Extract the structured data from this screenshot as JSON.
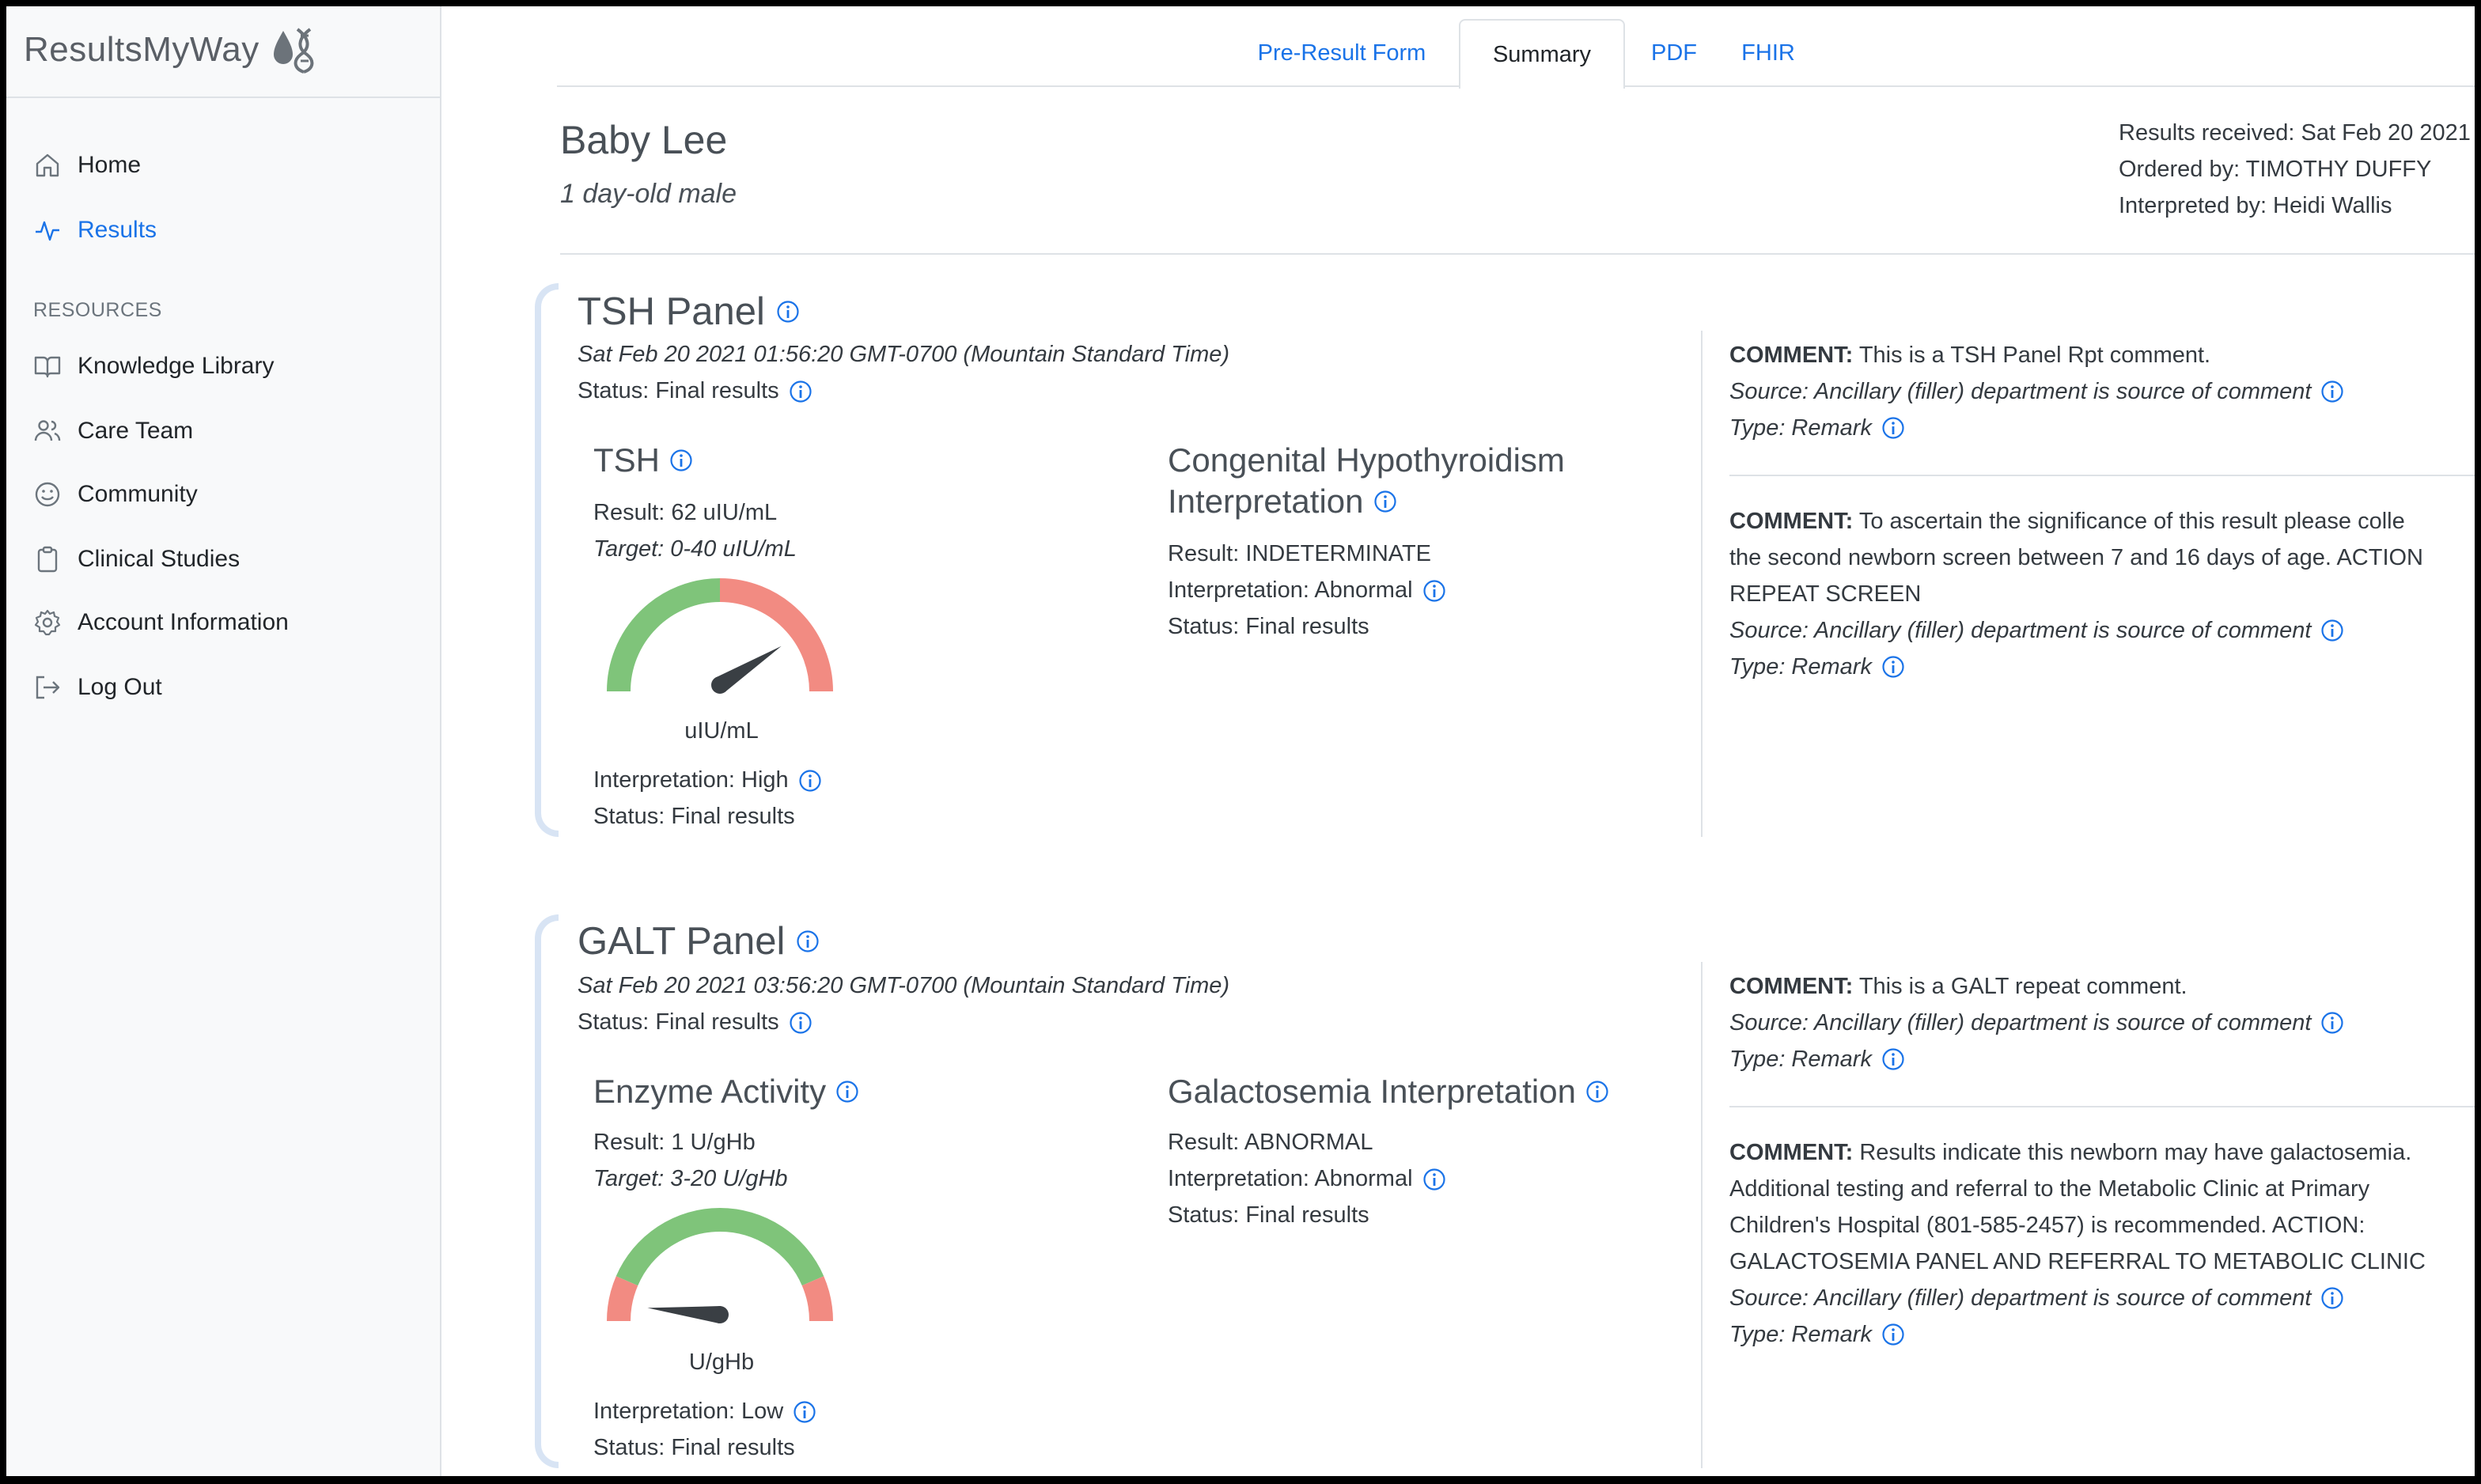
{
  "app": {
    "name": "ResultsMyWay"
  },
  "sidebar": {
    "nav": [
      {
        "label": "Home",
        "icon": "home-icon"
      },
      {
        "label": "Results",
        "icon": "activity-icon",
        "active": true
      }
    ],
    "resources_label": "RESOURCES",
    "resources": [
      {
        "label": "Knowledge Library",
        "icon": "book-icon"
      },
      {
        "label": "Care Team",
        "icon": "users-icon"
      },
      {
        "label": "Community",
        "icon": "smile-icon"
      },
      {
        "label": "Clinical Studies",
        "icon": "clipboard-icon"
      },
      {
        "label": "Account Information",
        "icon": "gear-icon"
      },
      {
        "label": "Log Out",
        "icon": "logout-icon"
      }
    ]
  },
  "tabs": [
    {
      "label": "Pre-Result Form"
    },
    {
      "label": "Summary",
      "active": true
    },
    {
      "label": "PDF"
    },
    {
      "label": "FHIR"
    }
  ],
  "patient": {
    "name": "Baby Lee",
    "subtitle": "1 day-old male",
    "results_received": "Results received: Sat Feb 20 2021",
    "ordered_by": "Ordered by: TIMOTHY DUFFY",
    "interpreted_by": "Interpreted by: Heidi Wallis"
  },
  "colors": {
    "accent": "#1a73e8",
    "gauge_green": "#7fc47a",
    "gauge_red": "#f28b82",
    "panel_bar": "#d8e4f4"
  },
  "panels": [
    {
      "title": "TSH Panel",
      "datetime": "Sat Feb 20 2021 01:56:20 GMT-0700 (Mountain Standard Time)",
      "status": "Status: Final results",
      "test": {
        "name": "TSH",
        "result": "Result: 62 uIU/mL",
        "target": "Target: 0-40 uIU/mL",
        "unit": "uIU/mL",
        "gauge": {
          "needle_fraction": 0.82,
          "zones": [
            "green",
            "red"
          ]
        },
        "interpretation": "Interpretation: High",
        "status": "Status: Final results"
      },
      "interp": {
        "title_line1": "Congenital Hypothyroidism",
        "title_line2": "Interpretation",
        "result": "Result: INDETERMINATE",
        "interpretation": "Interpretation: Abnormal",
        "status": "Status: Final results"
      },
      "comments": [
        {
          "label": "COMMENT:",
          "lines": [
            "This is a TSH Panel Rpt comment."
          ],
          "source": "Source: Ancillary (filler) department is source of comment",
          "type": "Type: Remark"
        },
        {
          "label": "COMMENT:",
          "lines": [
            "To ascertain the significance of this result please colle",
            "the second newborn screen between 7 and 16 days of age. ACTION",
            "REPEAT SCREEN"
          ],
          "source": "Source: Ancillary (filler) department is source of comment",
          "type": "Type: Remark"
        }
      ]
    },
    {
      "title": "GALT Panel",
      "datetime": "Sat Feb 20 2021 03:56:20 GMT-0700 (Mountain Standard Time)",
      "status": "Status: Final results",
      "test": {
        "name": "Enzyme Activity",
        "result": "Result: 1 U/gHb",
        "target": "Target: 3-20 U/gHb",
        "unit": "U/gHb",
        "gauge": {
          "needle_fraction": 0.03,
          "zones": [
            "red",
            "green",
            "red"
          ]
        },
        "interpretation": "Interpretation: Low",
        "status": "Status: Final results"
      },
      "interp": {
        "title_line1": "Galactosemia Interpretation",
        "title_line2": "",
        "result": "Result: ABNORMAL",
        "interpretation": "Interpretation: Abnormal",
        "status": "Status: Final results"
      },
      "comments": [
        {
          "label": "COMMENT:",
          "lines": [
            "This is a GALT repeat comment."
          ],
          "source": "Source: Ancillary (filler) department is source of comment",
          "type": "Type: Remark"
        },
        {
          "label": "COMMENT:",
          "lines": [
            "Results indicate this newborn may have galactosemia.",
            "Additional testing and referral to the Metabolic Clinic at Primary",
            "Children's Hospital (801-585-2457) is recommended. ACTION:",
            "GALACTOSEMIA PANEL AND REFERRAL TO METABOLIC CLINIC"
          ],
          "source": "Source: Ancillary (filler) department is source of comment",
          "type": "Type: Remark"
        }
      ]
    }
  ]
}
